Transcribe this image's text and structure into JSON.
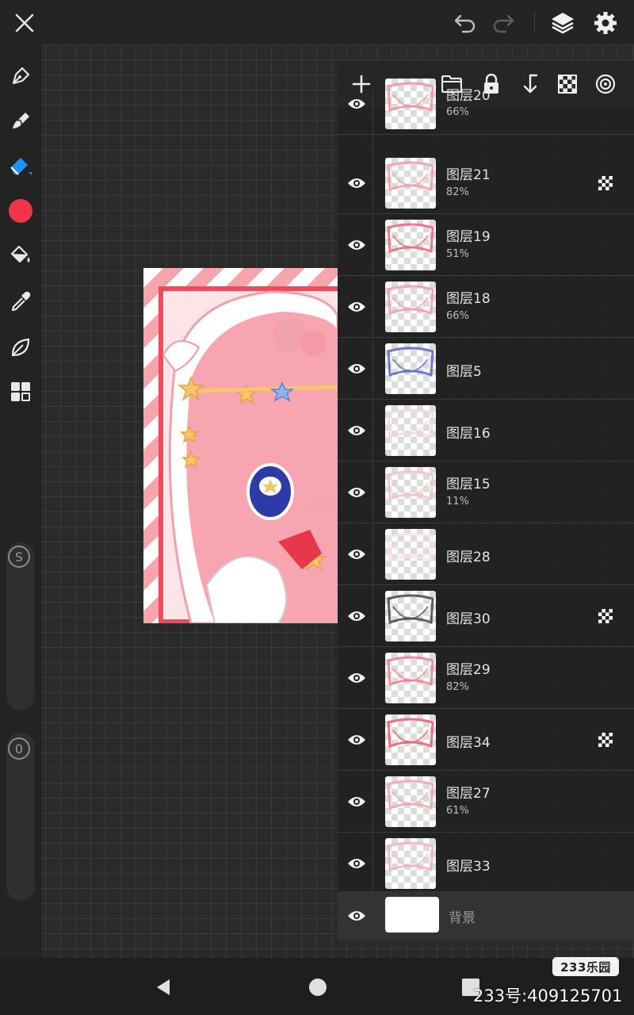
{
  "topbar": {
    "close_icon": "close-icon",
    "undo_icon": "undo-icon",
    "redo_icon": "redo-icon",
    "layers_icon": "layers-icon",
    "settings_icon": "gear-icon"
  },
  "left_toolbar": {
    "tools": [
      "pen-icon",
      "smudge-icon",
      "eraser-icon",
      "color-swatch",
      "fill-bucket-icon",
      "eyedropper-icon",
      "leaf-icon",
      "grid-menu-icon"
    ],
    "active_color": "#f0344a",
    "size_knob_label": "S",
    "opacity_knob_label": "0"
  },
  "layers_panel": {
    "toolbar_icons": [
      "add-layer-icon",
      "folder-icon",
      "lock-icon",
      "merge-down-icon",
      "checker-icon",
      "target-icon"
    ],
    "layers": [
      {
        "name": "图层20",
        "opacity": "66%",
        "clip": false
      },
      {
        "name": "图层21",
        "opacity": "82%",
        "clip": true
      },
      {
        "name": "图层19",
        "opacity": "51%",
        "clip": false
      },
      {
        "name": "图层18",
        "opacity": "66%",
        "clip": false
      },
      {
        "name": "图层5",
        "opacity": "",
        "clip": false
      },
      {
        "name": "图层16",
        "opacity": "",
        "clip": false
      },
      {
        "name": "图层15",
        "opacity": "11%",
        "clip": false
      },
      {
        "name": "图层28",
        "opacity": "",
        "clip": false
      },
      {
        "name": "图层30",
        "opacity": "",
        "clip": true
      },
      {
        "name": "图层29",
        "opacity": "82%",
        "clip": false
      },
      {
        "name": "图层34",
        "opacity": "",
        "clip": true
      },
      {
        "name": "图层27",
        "opacity": "61%",
        "clip": false
      },
      {
        "name": "图层33",
        "opacity": "",
        "clip": false
      }
    ],
    "background_layer": "背景"
  },
  "watermark": {
    "badge": "233乐园",
    "id_text": "233号:409125701"
  },
  "colors": {
    "accent_blue": "#1e90ff",
    "pink": "#f6a5ad"
  }
}
